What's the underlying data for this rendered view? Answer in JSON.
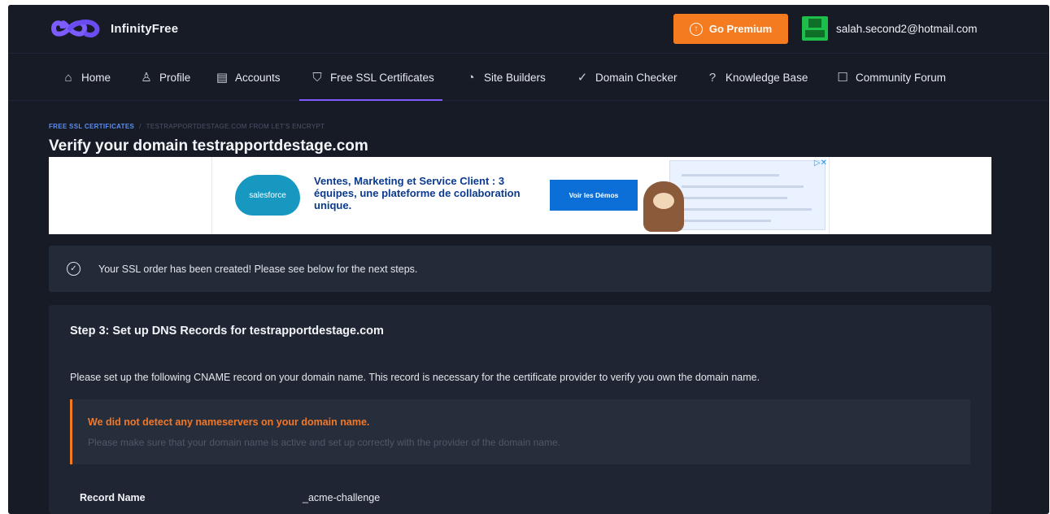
{
  "brand": {
    "name": "InfinityFree",
    "logo_color": "#7c5cff"
  },
  "header": {
    "premium_label": "Go Premium",
    "premium_color": "#f47b20",
    "user_email": "salah.second2@hotmail.com"
  },
  "nav": {
    "items": [
      {
        "label": "Home",
        "icon": "home-icon"
      },
      {
        "label": "Profile",
        "icon": "user-icon"
      },
      {
        "label": "Accounts",
        "icon": "server-icon"
      },
      {
        "label": "Free SSL Certificates",
        "icon": "shield-icon",
        "active": true
      },
      {
        "label": "Site Builders",
        "icon": "palette-icon"
      },
      {
        "label": "Domain Checker",
        "icon": "check-circle-icon"
      },
      {
        "label": "Knowledge Base",
        "icon": "help-circle-icon"
      },
      {
        "label": "Community Forum",
        "icon": "chat-icon"
      }
    ]
  },
  "breadcrumb": {
    "first": "FREE SSL CERTIFICATES",
    "separator": "/",
    "second": "TESTRAPPORTDESTAGE.COM FROM LET'S ENCRYPT"
  },
  "page_title": "Verify your domain testrapportdestage.com",
  "ad": {
    "brand": "salesforce",
    "text": "Ventes, Marketing et Service Client : 3 équipes, une plateforme de collaboration unique.",
    "cta": "Voir les Démos"
  },
  "alert": {
    "text": "Your SSL order has been created! Please see below for the next steps."
  },
  "step": {
    "title": "Step 3: Set up DNS Records for testrapportdestage.com",
    "description": "Please set up the following CNAME record on your domain name. This record is necessary for the certificate provider to verify you own the domain name.",
    "warning_title": "We did not detect any nameservers on your domain name.",
    "warning_text": "Please make sure that your domain name is active and set up correctly with the provider of the domain name.",
    "record_name_label": "Record Name",
    "record_name_value": "_acme-challenge"
  }
}
